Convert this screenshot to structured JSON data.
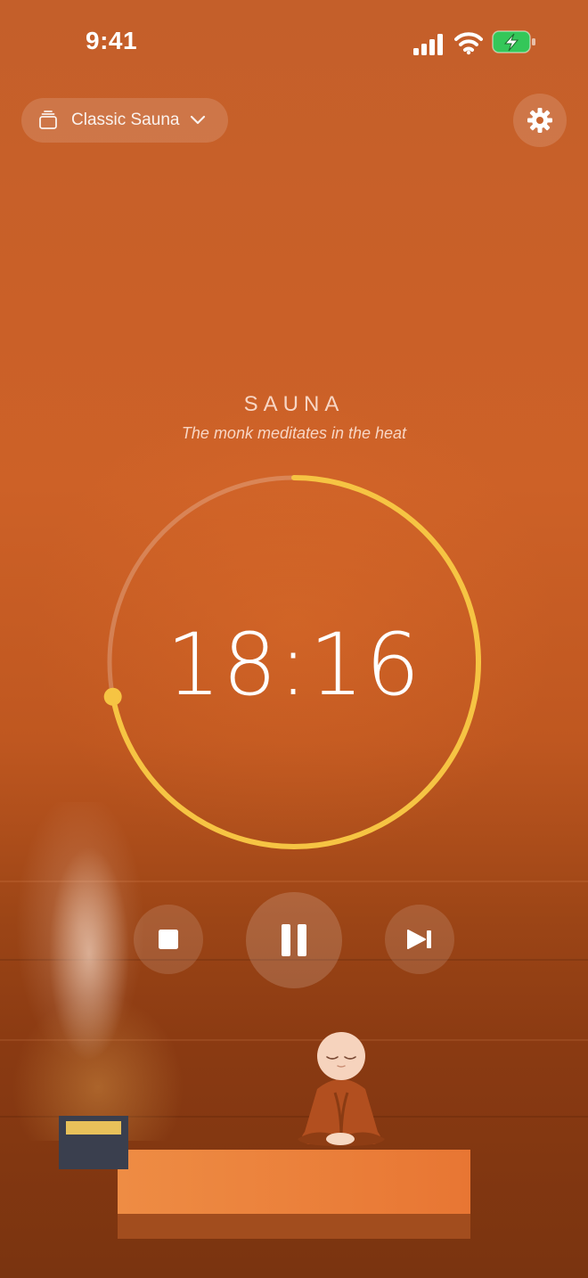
{
  "status_bar": {
    "time": "9:41"
  },
  "header": {
    "preset_label": "Classic Sauna",
    "preset_icon": "stack-icon",
    "settings_icon": "gear-icon"
  },
  "phase": {
    "title": "SAUNA",
    "subtitle": "The monk meditates in the heat"
  },
  "timer": {
    "remaining": "18:16",
    "progress": 0.72,
    "colors": {
      "progress": "#f6c443",
      "track": "rgba(255,255,255,0.22)"
    }
  },
  "controls": {
    "stop_icon": "stop-icon",
    "pause_icon": "pause-icon",
    "skip_icon": "skip-next-icon"
  },
  "colors": {
    "accent": "#f6c443",
    "background": "#cd6127",
    "battery": "#34c759"
  }
}
